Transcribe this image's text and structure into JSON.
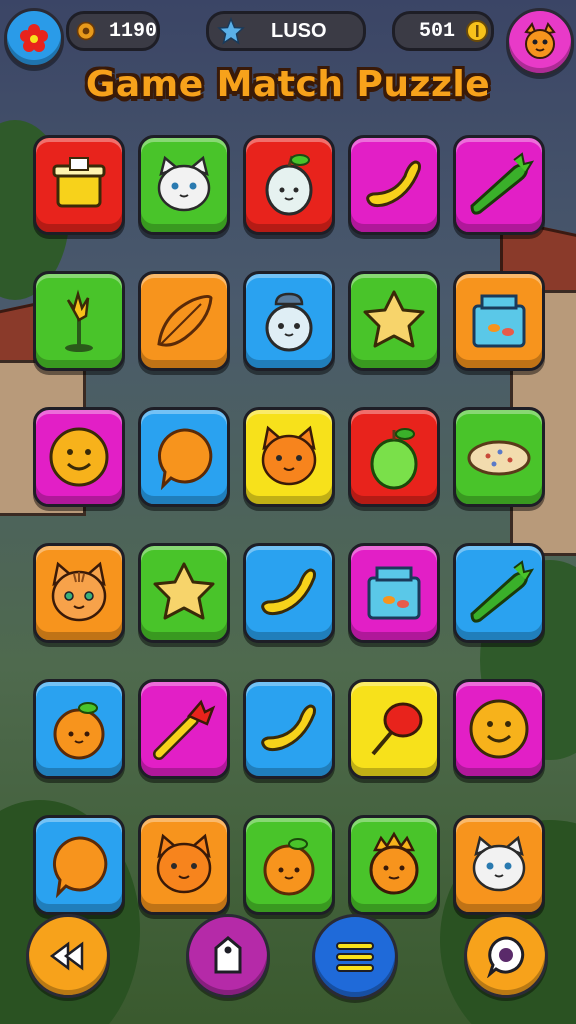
{
  "title": "Game Match Puzzle",
  "hud": {
    "left_icon": "flower-icon",
    "coins_icon": "gear-coin-icon",
    "coins_value": "1190",
    "center_icon": "star-icon",
    "center_label": "LUSO",
    "right_value": "501",
    "right_icon": "gold-coin-icon",
    "profile_icon": "cat-face-icon"
  },
  "colors": {
    "red": "#e8231c",
    "green": "#49c42a",
    "magenta": "#e21fc6",
    "blue": "#2aa2f0",
    "orange": "#f7941d",
    "yellow": "#f7e11b",
    "title": "#f7a21b"
  },
  "board": [
    [
      {
        "color": "red",
        "icon": "basket-icon"
      },
      {
        "color": "green",
        "icon": "white-cat-icon"
      },
      {
        "color": "red",
        "icon": "white-fruit-icon"
      },
      {
        "color": "magenta",
        "icon": "banana-icon"
      },
      {
        "color": "magenta",
        "icon": "cucumber-icon"
      }
    ],
    [
      {
        "color": "green",
        "icon": "flower-sprout-icon"
      },
      {
        "color": "orange",
        "icon": "leaf-icon"
      },
      {
        "color": "blue",
        "icon": "jar-cat-icon"
      },
      {
        "color": "green",
        "icon": "yellow-star-icon"
      },
      {
        "color": "orange",
        "icon": "fish-box-icon"
      }
    ],
    [
      {
        "color": "magenta",
        "icon": "smiley-icon"
      },
      {
        "color": "blue",
        "icon": "orange-bubble-icon"
      },
      {
        "color": "yellow",
        "icon": "orange-cat-icon"
      },
      {
        "color": "red",
        "icon": "green-apple-icon"
      },
      {
        "color": "green",
        "icon": "cookie-icon"
      }
    ],
    [
      {
        "color": "orange",
        "icon": "tabby-cat-icon"
      },
      {
        "color": "green",
        "icon": "yellow-star-icon"
      },
      {
        "color": "blue",
        "icon": "banana-icon"
      },
      {
        "color": "magenta",
        "icon": "fish-box-icon"
      },
      {
        "color": "blue",
        "icon": "cucumber-icon"
      }
    ],
    [
      {
        "color": "blue",
        "icon": "orange-fruit-icon"
      },
      {
        "color": "magenta",
        "icon": "torch-icon"
      },
      {
        "color": "blue",
        "icon": "banana-icon"
      },
      {
        "color": "yellow",
        "icon": "red-lollipop-icon"
      },
      {
        "color": "magenta",
        "icon": "smiley-icon"
      }
    ],
    [
      {
        "color": "blue",
        "icon": "orange-bubble-icon"
      },
      {
        "color": "orange",
        "icon": "orange-cat-icon"
      },
      {
        "color": "green",
        "icon": "orange-fruit-icon"
      },
      {
        "color": "green",
        "icon": "spiky-orange-icon"
      },
      {
        "color": "orange",
        "icon": "white-cat-icon"
      }
    ]
  ],
  "bottom_bar": [
    {
      "name": "back-button",
      "icon": "rewind-icon",
      "color": "#f7a21b"
    },
    {
      "name": "tag-button",
      "icon": "tag-icon",
      "color": "#b52aa8"
    },
    {
      "name": "menu-button",
      "icon": "menu-icon",
      "color": "#1f6ad9"
    },
    {
      "name": "chat-button",
      "icon": "chat-icon",
      "color": "#f7a21b"
    }
  ]
}
